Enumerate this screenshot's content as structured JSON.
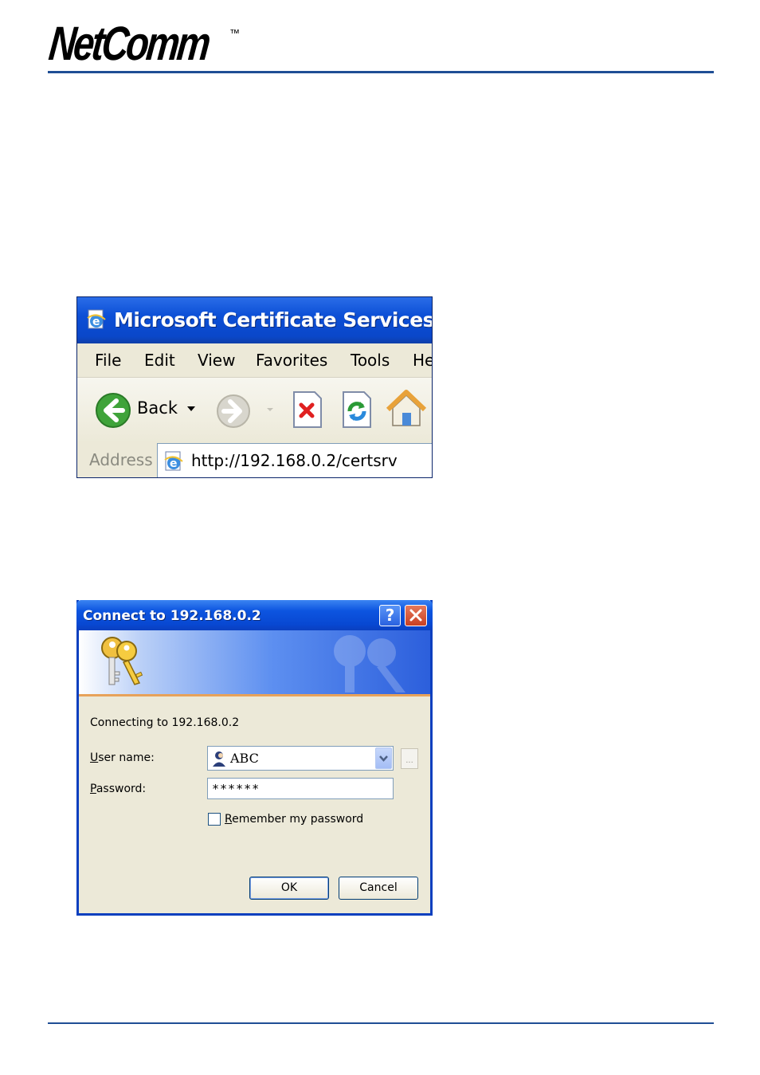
{
  "header": {
    "logo_text": "NetComm",
    "trademark": "™"
  },
  "browser": {
    "title": "Microsoft Certificate Services - Mi",
    "menu": [
      "File",
      "Edit",
      "View",
      "Favorites",
      "Tools",
      "He"
    ],
    "toolbar": {
      "back_label": "Back"
    },
    "address_label": "Address",
    "address_url": "http://192.168.0.2/certsrv",
    "icons": [
      "ie-page-icon",
      "back-arrow-icon",
      "dropdown-arrow-icon",
      "forward-arrow-icon",
      "stop-icon",
      "refresh-icon",
      "home-icon"
    ]
  },
  "dialog": {
    "title": "Connect to 192.168.0.2",
    "connecting_text": "Connecting to 192.168.0.2",
    "username_label_accel": "U",
    "username_label_rest": "ser name:",
    "username_value": "ABC",
    "password_label_accel": "P",
    "password_label_rest": "assword:",
    "password_value": "******",
    "remember_accel": "R",
    "remember_rest": "emember my password",
    "remember_checked": false,
    "ellipsis": "...",
    "help_glyph": "?",
    "ok_label": "OK",
    "cancel_label": "Cancel",
    "colors": {
      "title_blue": "#0a3fbf",
      "accent_orange": "#e7a25a",
      "dialog_bg": "#ece9d8"
    }
  }
}
